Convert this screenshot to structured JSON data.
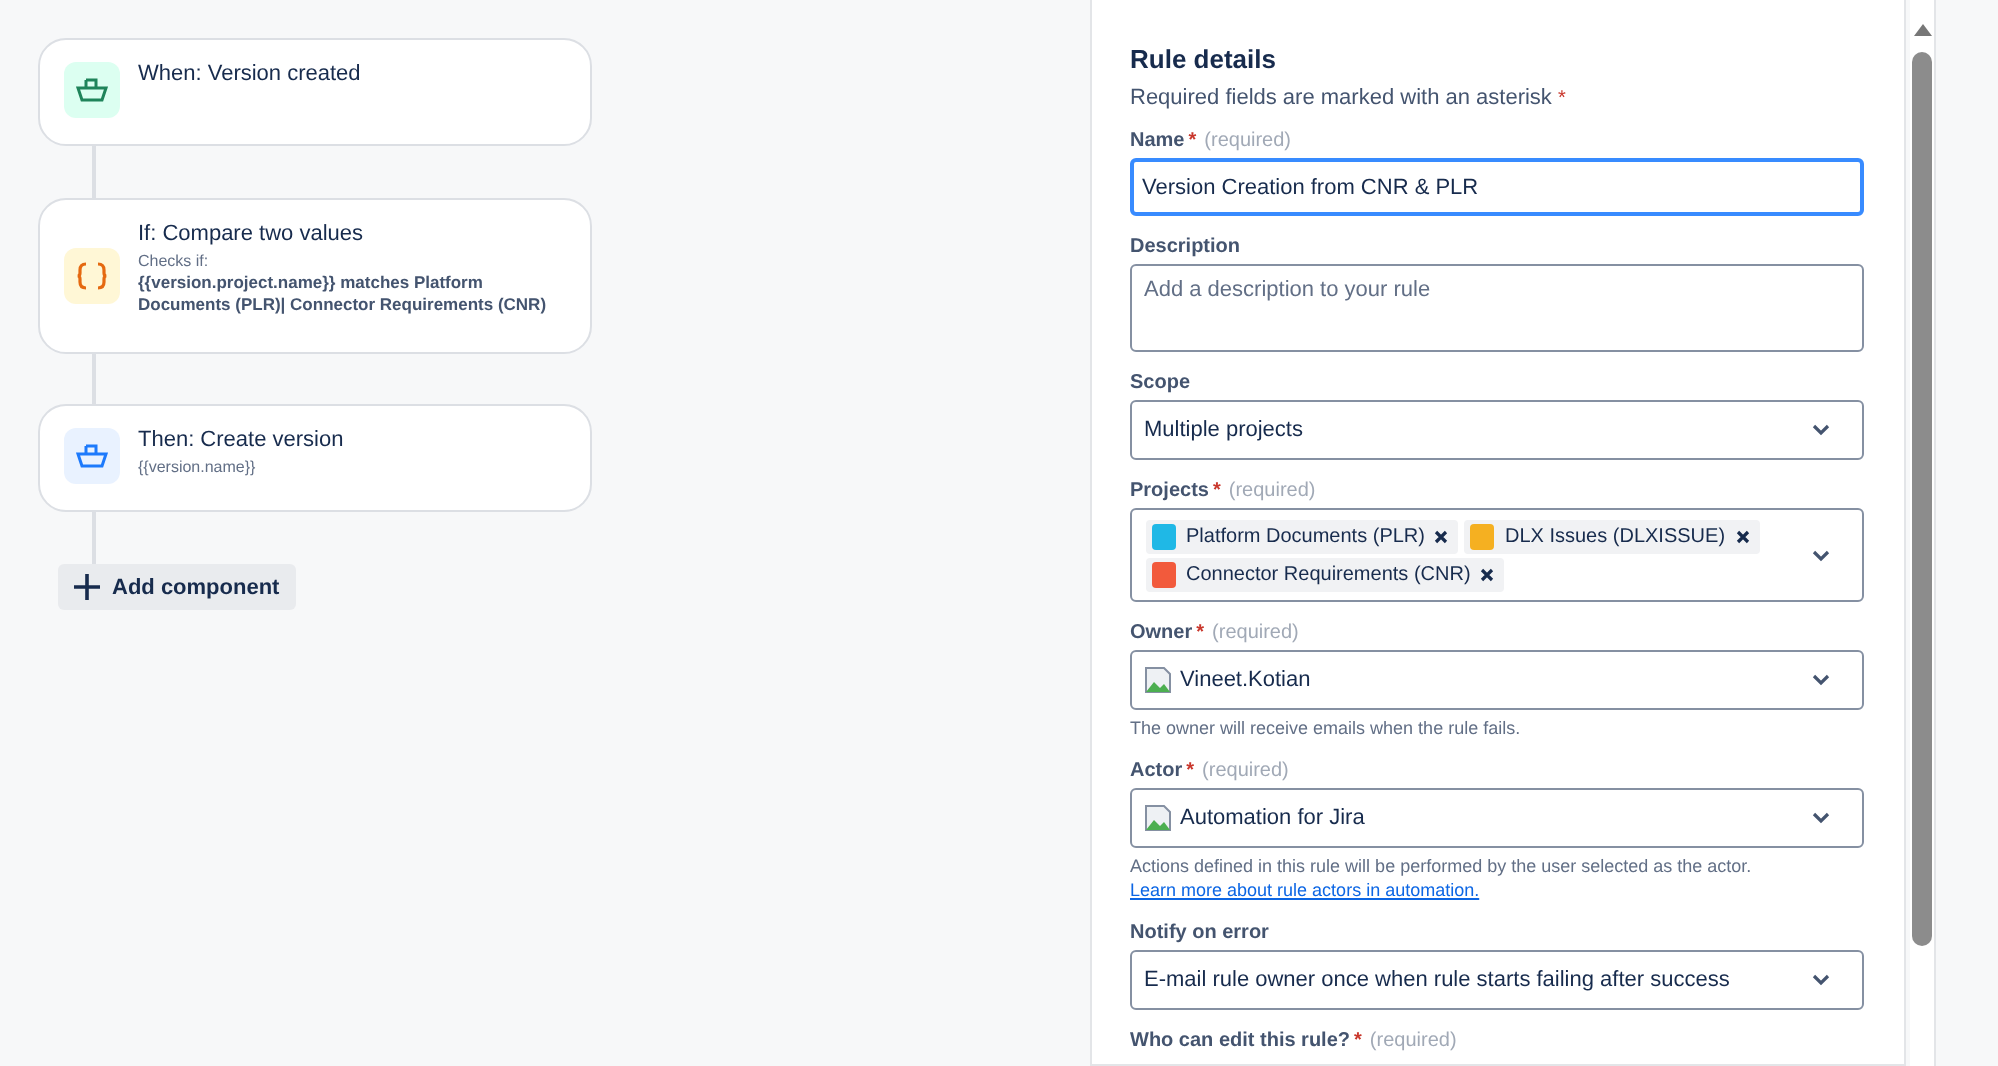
{
  "flow": {
    "steps": [
      {
        "kind": "trigger",
        "title": "When: Version created"
      },
      {
        "kind": "condition",
        "title": "If: Compare two values",
        "label": "Checks if:",
        "detail": "{{version.project.name}} matches Platform Documents (PLR)| Connector Requirements (CNR)"
      },
      {
        "kind": "action",
        "title": "Then: Create version",
        "label": "{{version.name}}"
      }
    ],
    "add_button": "Add component"
  },
  "panel": {
    "title": "Rule details",
    "intro": "Required fields are marked with an asterisk",
    "intro_mark": "*",
    "fields": [
      {
        "kind": "text",
        "label": "Name",
        "asterisk": "*",
        "note": "(required)",
        "value": "Version Creation from CNR & PLR",
        "focused": true
      },
      {
        "kind": "textarea",
        "label": "Description",
        "placeholder": "Add a description to your rule"
      },
      {
        "kind": "select",
        "label": "Scope",
        "value": "Multiple projects"
      },
      {
        "kind": "multi",
        "label": "Projects",
        "asterisk": "*",
        "note": "(required)",
        "tags": [
          {
            "label": "Platform Documents (PLR)",
            "color": "#1fb8e6"
          },
          {
            "label": "DLX Issues (DLXISSUE)",
            "color": "#f5b021"
          },
          {
            "label": "Connector Requirements (CNR)",
            "color": "#f25a3c"
          }
        ]
      },
      {
        "kind": "user",
        "label": "Owner",
        "asterisk": "*",
        "note": "(required)",
        "value": "Vineet.Kotian",
        "help": "The owner will receive emails when the rule fails."
      },
      {
        "kind": "user",
        "label": "Actor",
        "asterisk": "*",
        "note": "(required)",
        "value": "Automation for Jira",
        "help": "Actions defined in this rule will be performed by the user selected as the actor.",
        "link": "Learn more about rule actors in automation."
      },
      {
        "kind": "select",
        "label": "Notify on error",
        "value": "E-mail rule owner once when rule starts failing after success"
      },
      {
        "kind": "cut",
        "label": "Who can edit this rule?",
        "asterisk": "*",
        "note": "(required)"
      }
    ]
  }
}
